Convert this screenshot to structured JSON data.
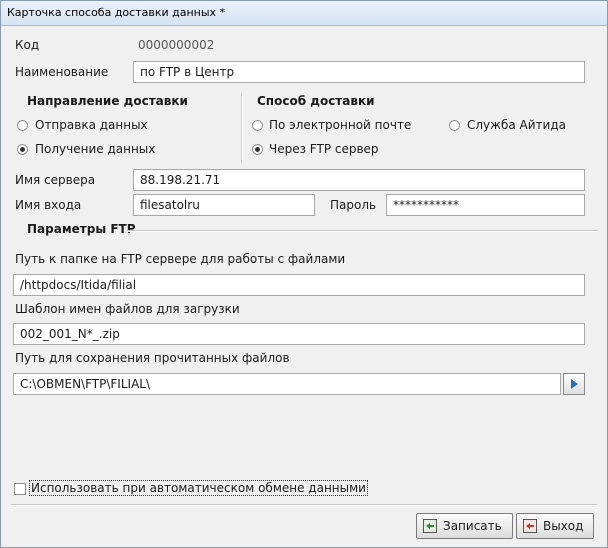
{
  "window": {
    "title": "Карточка способа доставки данных *"
  },
  "form": {
    "code_label": "Код",
    "code_value": "0000000002",
    "name_label": "Наименование",
    "name_value": "по FTP в Центр"
  },
  "direction": {
    "title": "Направление доставки",
    "options": [
      {
        "label": "Отправка данных",
        "selected": false
      },
      {
        "label": "Получение данных",
        "selected": true
      }
    ]
  },
  "method": {
    "title": "Способ доставки",
    "options": [
      {
        "label": "По электронной почте",
        "selected": false
      },
      {
        "label": "Служба Айтида",
        "selected": false
      },
      {
        "label": "Через FTP сервер",
        "selected": true
      }
    ]
  },
  "server": {
    "server_label": "Имя сервера",
    "server_value": "88.198.21.71",
    "login_label": "Имя входа",
    "login_value": "filesatolru",
    "password_label": "Пароль",
    "password_value": "***********"
  },
  "ftp": {
    "title": "Параметры FTP",
    "folder_label": "Путь к папке на FTP сервере для работы с файлами",
    "folder_value": "/httpdocs/Itida/filial",
    "template_label": "Шаблон имен файлов для загрузки",
    "template_value": "002_001_N*_.zip",
    "save_label": "Путь для сохранения прочитанных файлов",
    "save_value": "C:\\OBMEN\\FTP\\FILIAL\\"
  },
  "auto": {
    "label": "Использовать при автоматическом обмене данными",
    "checked": false
  },
  "buttons": {
    "save": "Записать",
    "exit": "Выход"
  },
  "colors": {
    "save_icon": "#2e8b3a",
    "exit_icon": "#c0392b",
    "browse_icon": "#2c6db8"
  }
}
